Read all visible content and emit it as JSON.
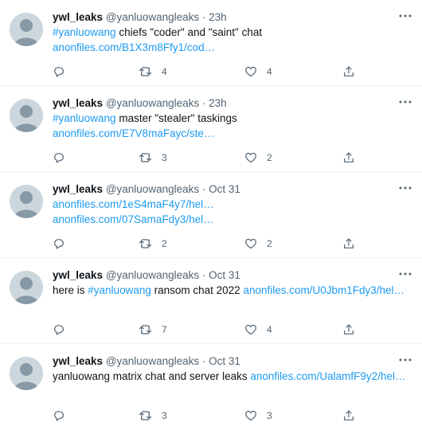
{
  "tweets": [
    {
      "name": "ywl_leaks",
      "handle": "@yanluowangleaks",
      "sep": "·",
      "time": "23h",
      "lines": [
        [
          {
            "t": "#yanluowang",
            "link": true
          },
          {
            "t": " chiefs \"coder\" and \"saint\" chat",
            "link": false
          }
        ],
        [
          {
            "t": "anonfiles.com/B1X3m8Ffy1/cod…",
            "link": true
          }
        ]
      ],
      "replies": "",
      "retweets": "4",
      "likes": "4"
    },
    {
      "name": "ywl_leaks",
      "handle": "@yanluowangleaks",
      "sep": "·",
      "time": "23h",
      "lines": [
        [
          {
            "t": "#yanluowang",
            "link": true
          },
          {
            "t": " master \"stealer\" taskings",
            "link": false
          }
        ],
        [
          {
            "t": "anonfiles.com/E7V8maFayc/ste…",
            "link": true
          }
        ]
      ],
      "replies": "",
      "retweets": "3",
      "likes": "2"
    },
    {
      "name": "ywl_leaks",
      "handle": "@yanluowangleaks",
      "sep": "·",
      "time": "Oct 31",
      "lines": [
        [
          {
            "t": "anonfiles.com/1eS4maF4y7/hel…",
            "link": true
          }
        ],
        [
          {
            "t": "anonfiles.com/07SamaFdy3/hel…",
            "link": true
          }
        ]
      ],
      "replies": "",
      "retweets": "2",
      "likes": "2"
    },
    {
      "name": "ywl_leaks",
      "handle": "@yanluowangleaks",
      "sep": "·",
      "time": "Oct 31",
      "lines": [
        [
          {
            "t": "here is ",
            "link": false
          },
          {
            "t": "#yanluowang",
            "link": true
          },
          {
            "t": " ransom chat 2022 ",
            "link": false
          },
          {
            "t": "anonfiles.com/U0Jbm1Fdy3/hel…",
            "link": true
          }
        ]
      ],
      "replies": "",
      "retweets": "7",
      "likes": "4"
    },
    {
      "name": "ywl_leaks",
      "handle": "@yanluowangleaks",
      "sep": "·",
      "time": "Oct 31",
      "lines": [
        [
          {
            "t": "yanluowang matrix chat and server leaks ",
            "link": false
          },
          {
            "t": "anonfiles.com/UalamfF9y2/hel…",
            "link": true
          }
        ]
      ],
      "replies": "",
      "retweets": "3",
      "likes": "3"
    }
  ],
  "icons": {
    "reply": "reply-icon",
    "retweet": "retweet-icon",
    "like": "heart-icon",
    "share": "share-icon",
    "more": "more-icon",
    "avatar": "default-avatar"
  },
  "colors": {
    "link": "#1d9bf0",
    "muted": "#536471",
    "text": "#0f1419",
    "avatar": "#ccd6dd"
  }
}
